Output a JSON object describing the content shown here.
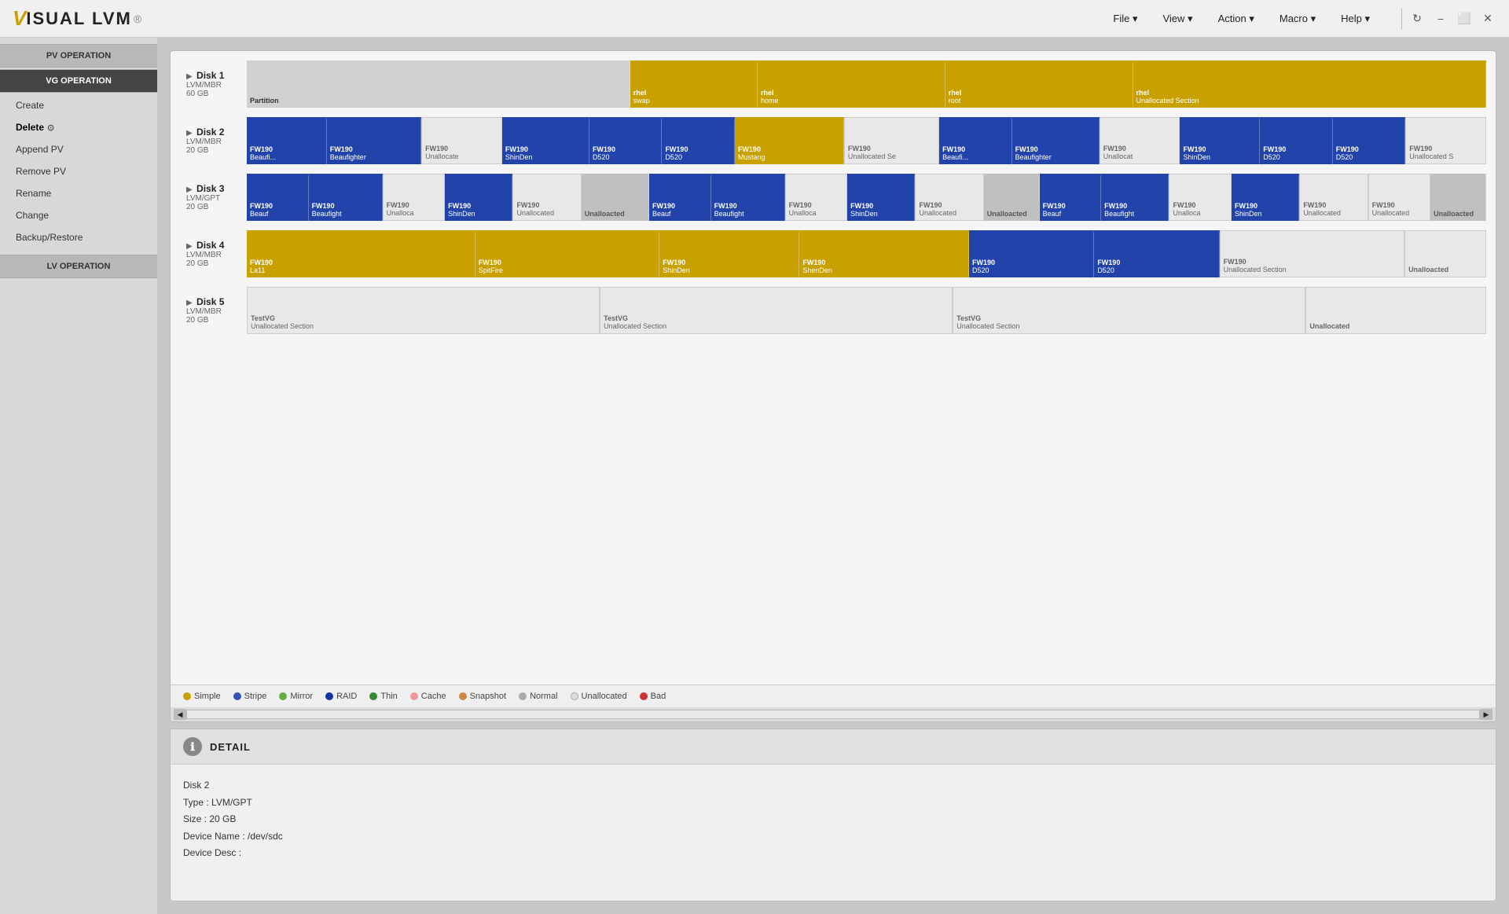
{
  "app": {
    "logo_v": "V",
    "logo_text": "ISUAL LVM",
    "logo_reg": "®"
  },
  "menubar": {
    "items": [
      {
        "id": "file",
        "label": "File",
        "has_arrow": true
      },
      {
        "id": "view",
        "label": "View",
        "has_arrow": true
      },
      {
        "id": "action",
        "label": "Action",
        "has_arrow": true
      },
      {
        "id": "macro",
        "label": "Macro",
        "has_arrow": true
      },
      {
        "id": "help",
        "label": "Help",
        "has_arrow": true
      }
    ],
    "window_controls": {
      "refresh": "↻",
      "minimize": "−",
      "maximize": "□",
      "close": "✕"
    }
  },
  "sidebar": {
    "sections": [
      {
        "id": "pv-operation",
        "label": "PV OPERATION",
        "active": false,
        "items": []
      },
      {
        "id": "vg-operation",
        "label": "VG OPERATION",
        "active": true,
        "items": [
          {
            "id": "create",
            "label": "Create"
          },
          {
            "id": "delete",
            "label": "Delete"
          },
          {
            "id": "append-pv",
            "label": "Append PV"
          },
          {
            "id": "remove-pv",
            "label": "Remove PV"
          },
          {
            "id": "rename",
            "label": "Rename"
          },
          {
            "id": "change",
            "label": "Change"
          },
          {
            "id": "backup-restore",
            "label": "Backup/Restore"
          }
        ]
      },
      {
        "id": "lv-operation",
        "label": "LV OPERATION",
        "active": false,
        "items": []
      }
    ]
  },
  "disks": [
    {
      "id": "disk1",
      "name": "Disk 1",
      "type": "LVM/MBR",
      "size": "60 GB",
      "segments": [
        {
          "id": "d1s1",
          "type": "partition",
          "class": "seg-partition",
          "flex": 2.5,
          "top_bar": false,
          "name": "Partition",
          "vg": ""
        },
        {
          "id": "d1s2",
          "type": "simple",
          "class": "seg-simple",
          "flex": 0.8,
          "top_bar": true,
          "name": "rhel",
          "vg": "swap"
        },
        {
          "id": "d1s3",
          "type": "simple",
          "class": "seg-simple",
          "flex": 1.2,
          "top_bar": true,
          "name": "rhel",
          "vg": "home"
        },
        {
          "id": "d1s4",
          "type": "simple",
          "class": "seg-simple",
          "flex": 1.2,
          "top_bar": true,
          "name": "rhel",
          "vg": "root"
        },
        {
          "id": "d1s5",
          "type": "simple",
          "class": "seg-simple",
          "flex": 2.3,
          "top_bar": true,
          "name": "rhel",
          "vg": "Unallocated Section"
        }
      ]
    },
    {
      "id": "disk2",
      "name": "Disk 2",
      "type": "LVM/MBR",
      "size": "20 GB",
      "segments": [
        {
          "id": "d2s1",
          "type": "stripe",
          "class": "seg-stripe",
          "flex": 0.5,
          "top_bar": true,
          "name": "FW190",
          "vg": "Beaufic"
        },
        {
          "id": "d2s2",
          "type": "stripe",
          "class": "seg-stripe",
          "flex": 0.6,
          "top_bar": true,
          "name": "FW190",
          "vg": "Beaufighter"
        },
        {
          "id": "d2s3",
          "type": "unallocated",
          "class": "seg-unallocated",
          "flex": 0.5,
          "top_bar": false,
          "name": "FW190",
          "vg": "Unallocated"
        },
        {
          "id": "d2s4",
          "type": "stripe",
          "class": "seg-stripe",
          "flex": 0.55,
          "top_bar": true,
          "name": "FW190",
          "vg": "ShinDen"
        },
        {
          "id": "d2s5",
          "type": "stripe",
          "class": "seg-stripe",
          "flex": 0.45,
          "top_bar": true,
          "name": "FW190",
          "vg": "D520"
        },
        {
          "id": "d2s6",
          "type": "stripe",
          "class": "seg-stripe",
          "flex": 0.45,
          "top_bar": true,
          "name": "FW190",
          "vg": "D520"
        },
        {
          "id": "d2s7",
          "type": "simple",
          "class": "seg-simple",
          "flex": 0.7,
          "top_bar": true,
          "name": "FW190",
          "vg": "Mustang"
        },
        {
          "id": "d2s8",
          "type": "unallocated",
          "class": "seg-unallocated",
          "flex": 0.6,
          "top_bar": false,
          "name": "FW190",
          "vg": "Unallocated Se"
        },
        {
          "id": "d2s9",
          "type": "stripe",
          "class": "seg-stripe",
          "flex": 0.45,
          "top_bar": true,
          "name": "FW190",
          "vg": "Beaufic"
        },
        {
          "id": "d2s10",
          "type": "stripe",
          "class": "seg-stripe",
          "flex": 0.55,
          "top_bar": true,
          "name": "FW190",
          "vg": "Beaufighter"
        },
        {
          "id": "d2s11",
          "type": "unallocated",
          "class": "seg-unallocated",
          "flex": 0.5,
          "top_bar": false,
          "name": "FW190",
          "vg": "Unallocat"
        },
        {
          "id": "d2s12",
          "type": "stripe",
          "class": "seg-stripe",
          "flex": 0.5,
          "top_bar": true,
          "name": "FW190",
          "vg": "ShinDen"
        },
        {
          "id": "d2s13",
          "type": "stripe",
          "class": "seg-stripe",
          "flex": 0.45,
          "top_bar": true,
          "name": "FW190",
          "vg": "D520"
        },
        {
          "id": "d2s14",
          "type": "stripe",
          "class": "seg-stripe",
          "flex": 0.45,
          "top_bar": true,
          "name": "FW190",
          "vg": "D520"
        },
        {
          "id": "d2s15",
          "type": "unallocated",
          "class": "seg-unallocated",
          "flex": 0.5,
          "top_bar": false,
          "name": "FW190",
          "vg": "Unallocated S"
        }
      ]
    },
    {
      "id": "disk3",
      "name": "Disk 3",
      "type": "LVM/GPT",
      "size": "20 GB",
      "segments": [
        {
          "id": "d3s1",
          "type": "stripe",
          "class": "seg-stripe",
          "flex": 0.45,
          "top_bar": true,
          "name": "FW190",
          "vg": "Beauf"
        },
        {
          "id": "d3s2",
          "type": "stripe",
          "class": "seg-stripe",
          "flex": 0.55,
          "top_bar": true,
          "name": "FW190",
          "vg": "Beaufight"
        },
        {
          "id": "d3s3",
          "type": "unallocated",
          "class": "seg-unallocated",
          "flex": 0.45,
          "top_bar": false,
          "name": "FW190",
          "vg": "Unalloca"
        },
        {
          "id": "d3s4",
          "type": "stripe",
          "class": "seg-stripe",
          "flex": 0.5,
          "top_bar": true,
          "name": "FW190",
          "vg": "ShinDen"
        },
        {
          "id": "d3s5",
          "type": "unallocated",
          "class": "seg-unallocated",
          "flex": 0.5,
          "top_bar": false,
          "name": "FW190",
          "vg": "Unallocated"
        },
        {
          "id": "d3s6",
          "type": "unallocated",
          "class": "seg-unallocated-dark",
          "flex": 0.5,
          "top_bar": false,
          "name": "Unallocated",
          "vg": ""
        },
        {
          "id": "d3s7",
          "type": "stripe",
          "class": "seg-stripe",
          "flex": 0.45,
          "top_bar": true,
          "name": "FW190",
          "vg": "Beauf"
        },
        {
          "id": "d3s8",
          "type": "stripe",
          "class": "seg-stripe",
          "flex": 0.55,
          "top_bar": true,
          "name": "FW190",
          "vg": "Beaufight"
        },
        {
          "id": "d3s9",
          "type": "unallocated",
          "class": "seg-unallocated",
          "flex": 0.45,
          "top_bar": false,
          "name": "FW190",
          "vg": "Unalloca"
        },
        {
          "id": "d3s10",
          "type": "stripe",
          "class": "seg-stripe",
          "flex": 0.5,
          "top_bar": true,
          "name": "FW190",
          "vg": "ShinDen"
        },
        {
          "id": "d3s11",
          "type": "unallocated",
          "class": "seg-unallocated",
          "flex": 0.5,
          "top_bar": false,
          "name": "FW190",
          "vg": "Unallocated"
        },
        {
          "id": "d3s12",
          "type": "unallocated",
          "class": "seg-unallocated-dark",
          "flex": 0.4,
          "top_bar": false,
          "name": "Unallocated",
          "vg": ""
        },
        {
          "id": "d3s13",
          "type": "stripe",
          "class": "seg-stripe",
          "flex": 0.45,
          "top_bar": true,
          "name": "FW190",
          "vg": "Beauf"
        },
        {
          "id": "d3s14",
          "type": "stripe",
          "class": "seg-stripe",
          "flex": 0.5,
          "top_bar": true,
          "name": "FW190",
          "vg": "Beaufight"
        },
        {
          "id": "d3s15",
          "type": "unallocated",
          "class": "seg-unallocated",
          "flex": 0.45,
          "top_bar": false,
          "name": "FW190",
          "vg": "Unalloca"
        },
        {
          "id": "d3s16",
          "type": "stripe",
          "class": "seg-stripe",
          "flex": 0.5,
          "top_bar": true,
          "name": "FW190",
          "vg": "ShinDen"
        },
        {
          "id": "d3s17",
          "type": "unallocated",
          "class": "seg-unallocated",
          "flex": 0.5,
          "top_bar": false,
          "name": "FW190",
          "vg": "Unallocated"
        },
        {
          "id": "d3s18",
          "type": "unallocated",
          "class": "seg-unallocated",
          "flex": 0.45,
          "top_bar": false,
          "name": "FW190",
          "vg": "Unallocated"
        },
        {
          "id": "d3s19",
          "type": "unallocated",
          "class": "seg-unallocated-dark",
          "flex": 0.4,
          "top_bar": false,
          "name": "Unallocated",
          "vg": ""
        }
      ]
    },
    {
      "id": "disk4",
      "name": "Disk 4",
      "type": "LVM/MBR",
      "size": "20 GB",
      "segments": [
        {
          "id": "d4s1",
          "type": "simple",
          "class": "seg-simple",
          "flex": 1.5,
          "top_bar": true,
          "name": "FW190",
          "vg": "La11"
        },
        {
          "id": "d4s2",
          "type": "simple",
          "class": "seg-simple",
          "flex": 1.2,
          "top_bar": true,
          "name": "FW190",
          "vg": "SpitFire"
        },
        {
          "id": "d4s3",
          "type": "simple",
          "class": "seg-simple",
          "flex": 0.9,
          "top_bar": true,
          "name": "FW190",
          "vg": "ShinDen"
        },
        {
          "id": "d4s4",
          "type": "simple",
          "class": "seg-simple",
          "flex": 1.1,
          "top_bar": true,
          "name": "FW190",
          "vg": "ShenDen"
        },
        {
          "id": "d4s5",
          "type": "stripe",
          "class": "seg-stripe",
          "flex": 0.8,
          "top_bar": true,
          "name": "FW190",
          "vg": "D520"
        },
        {
          "id": "d4s6",
          "type": "stripe",
          "class": "seg-stripe",
          "flex": 0.8,
          "top_bar": true,
          "name": "FW190",
          "vg": "D520"
        },
        {
          "id": "d4s7",
          "type": "unallocated",
          "class": "seg-unallocated",
          "flex": 1.2,
          "top_bar": false,
          "name": "FW190",
          "vg": "Unallocated Section"
        },
        {
          "id": "d4s8",
          "type": "unallocated",
          "class": "seg-unallocated",
          "flex": 0.5,
          "top_bar": false,
          "name": "Unalloacted",
          "vg": ""
        }
      ]
    },
    {
      "id": "disk5",
      "name": "Disk 5",
      "type": "LVM/MBR",
      "size": "20 GB",
      "segments": [
        {
          "id": "d5s1",
          "type": "unallocated",
          "class": "seg-unallocated",
          "flex": 2,
          "top_bar": false,
          "name": "TestVG",
          "vg": "Unallocated Section"
        },
        {
          "id": "d5s2",
          "type": "unallocated",
          "class": "seg-unallocated",
          "flex": 2,
          "top_bar": false,
          "name": "TestVG",
          "vg": "Unallocated Section"
        },
        {
          "id": "d5s3",
          "type": "unallocated",
          "class": "seg-unallocated",
          "flex": 2,
          "top_bar": false,
          "name": "TestVG",
          "vg": "Unallocated Section"
        },
        {
          "id": "d5s4",
          "type": "unallocated",
          "class": "seg-unallocated",
          "flex": 1,
          "top_bar": false,
          "name": "Unallocated",
          "vg": ""
        }
      ]
    }
  ],
  "legend": [
    {
      "id": "simple",
      "dot_class": "simple",
      "label": "Simple"
    },
    {
      "id": "stripe",
      "dot_class": "stripe",
      "label": "Stripe"
    },
    {
      "id": "mirror",
      "dot_class": "mirror",
      "label": "Mirror"
    },
    {
      "id": "raid",
      "dot_class": "raid",
      "label": "RAID"
    },
    {
      "id": "thin",
      "dot_class": "thin",
      "label": "Thin"
    },
    {
      "id": "cache",
      "dot_class": "cache",
      "label": "Cache"
    },
    {
      "id": "snapshot",
      "dot_class": "snapshot",
      "label": "Snapshot"
    },
    {
      "id": "normal",
      "dot_class": "normal",
      "label": "Normal"
    },
    {
      "id": "unallocated",
      "dot_class": "unallocated",
      "label": "Unallocated"
    },
    {
      "id": "bad",
      "dot_class": "bad",
      "label": "Bad"
    }
  ],
  "detail": {
    "section_title": "DETAIL",
    "disk_name": "Disk 2",
    "type_label": "Type :",
    "type_value": "LVM/GPT",
    "size_label": "Size :",
    "size_value": "20 GB",
    "device_name_label": "Device Name :",
    "device_name_value": "/dev/sdc",
    "device_desc_label": "Device Desc :",
    "device_desc_value": ""
  }
}
